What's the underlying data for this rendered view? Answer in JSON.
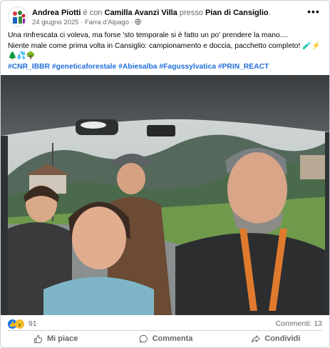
{
  "post": {
    "author": "Andrea Piotti",
    "with_text": "è con",
    "tagged": "Camilla Avanzi Villa",
    "at_text": "presso",
    "place": "Pian di Cansiglio",
    "date": "24 giugno 2025",
    "location": "Farra d'Alpago",
    "privacy_icon": "globe-icon",
    "line1": "Una rinfrescata ci voleva, ma forse 'sto temporale si è fatto un po' prendere la mano....",
    "line2": "Niente male come prima volta in Cansiglio: campionamento e doccia, pacchetto completo!",
    "line2_emoji": "🧪⚡",
    "line3_emoji": "🌲💦🌳",
    "hashtags": [
      "#CNR_IBBR",
      "#geneticaforestale",
      "#Abiesalba",
      "#Fagussylvatica",
      "#PRIN_REACT"
    ]
  },
  "stats": {
    "reaction_count": "91",
    "comments": "Commenti: 13"
  },
  "actions": {
    "like": "Mi piace",
    "comment": "Commenta",
    "share": "Condividi"
  },
  "colors": {
    "link": "#216fdb",
    "muted": "#65676b",
    "like_blue": "#1877f2"
  }
}
